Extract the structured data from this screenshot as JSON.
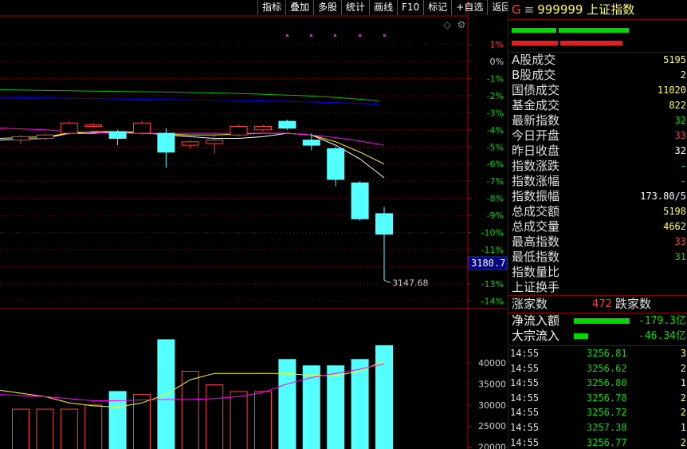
{
  "toolbar": [
    "指标",
    "叠加",
    "多股",
    "统计",
    "画线",
    "F10",
    "标记",
    "+自选",
    "返回"
  ],
  "header": {
    "prefix": "G",
    "menu": "≡",
    "code": "999999",
    "name": "上证指数"
  },
  "axis": {
    "pct_labels": [
      "1%",
      "0%",
      "-1%",
      "-2%",
      "-3%",
      "-4%",
      "-5%",
      "-6%",
      "-7%",
      "-8%",
      "-9%",
      "-10%",
      "-11%",
      "-12%",
      "-13%",
      "-14%"
    ],
    "current_price_tag": "3180.7",
    "low_annotation": "3147.68",
    "vol_labels": [
      "40000",
      "35000",
      "30000",
      "25000",
      "20000"
    ]
  },
  "colors": {
    "up": "#ff4040",
    "down": "#54ffff",
    "axis": "#800000",
    "ma1": "#ffffff",
    "ma2": "#ffff00",
    "ma3": "#ff00ff",
    "ma4": "#00c000",
    "ma5": "#0000ff"
  },
  "chart_data": {
    "type": "candlestick",
    "candles": [
      {
        "o": -4.6,
        "c": -4.4,
        "h": -4.3,
        "l": -4.8
      },
      {
        "o": -4.5,
        "c": -4.3,
        "h": -4.2,
        "l": -4.6
      },
      {
        "o": -4.2,
        "c": -3.6,
        "h": -3.5,
        "l": -4.3
      },
      {
        "o": -3.8,
        "c": -3.7,
        "h": -3.6,
        "l": -3.9
      },
      {
        "o": -4.1,
        "c": -4.5,
        "h": -4.0,
        "l": -4.9
      },
      {
        "o": -4.2,
        "c": -3.6,
        "h": -3.5,
        "l": -4.3
      },
      {
        "o": -4.2,
        "c": -5.3,
        "h": -3.9,
        "l": -6.2
      },
      {
        "o": -4.9,
        "c": -4.7,
        "h": -4.6,
        "l": -5.1
      },
      {
        "o": -4.8,
        "c": -4.6,
        "h": -4.2,
        "l": -5.4
      },
      {
        "o": -4.3,
        "c": -3.8,
        "h": -3.7,
        "l": -4.4
      },
      {
        "o": -4.0,
        "c": -3.8,
        "h": -3.7,
        "l": -4.1
      },
      {
        "o": -3.5,
        "c": -3.9,
        "h": -3.4,
        "l": -4.0
      },
      {
        "o": -4.6,
        "c": -4.9,
        "h": -4.2,
        "l": -5.2
      },
      {
        "o": -5.1,
        "c": -6.9,
        "h": -5.0,
        "l": -7.3
      },
      {
        "o": -7.1,
        "c": -9.2,
        "h": -7.0,
        "l": -9.3
      },
      {
        "o": -8.9,
        "c": -10.1,
        "h": -8.5,
        "l": -12.8
      }
    ],
    "ma_series": [
      {
        "values": [
          -4.6,
          -4.5,
          -4.2,
          -4.2,
          -4.1,
          -4.15,
          -4.3,
          -4.4,
          -4.5,
          -4.5,
          -4.4,
          -4.2,
          -4.3,
          -4.9,
          -5.7,
          -6.8
        ]
      },
      {
        "values": [
          -4.5,
          -4.4,
          -4.2,
          -4.1,
          -4.1,
          -4.2,
          -4.25,
          -4.3,
          -4.3,
          -4.25,
          -4.2,
          -4.2,
          -4.3,
          -4.7,
          -5.3,
          -6.0
        ]
      },
      {
        "values": [
          -3.9,
          -4.0,
          -4.1,
          -4.15,
          -4.2,
          -4.2,
          -4.2,
          -4.2,
          -4.2,
          -4.2,
          -4.2,
          -4.2,
          -4.3,
          -4.45,
          -4.65,
          -4.9
        ]
      },
      {
        "values": [
          -1.65,
          -1.68,
          -1.7,
          -1.72,
          -1.74,
          -1.76,
          -1.78,
          -1.8,
          -1.83,
          -1.86,
          -1.9,
          -1.95,
          -2.0,
          -2.08,
          -2.18,
          -2.3
        ]
      },
      {
        "values": [
          -2.1,
          -2.12,
          -2.14,
          -2.16,
          -2.18,
          -2.2,
          -2.22,
          -2.24,
          -2.26,
          -2.28,
          -2.3,
          -2.33,
          -2.36,
          -2.4,
          -2.45,
          -2.5
        ]
      }
    ],
    "volume": [
      {
        "v": 29000,
        "up": true
      },
      {
        "v": 29000,
        "up": true
      },
      {
        "v": 29000,
        "up": true
      },
      {
        "v": 30000,
        "up": true
      },
      {
        "v": 33200,
        "up": false
      },
      {
        "v": 32500,
        "up": true
      },
      {
        "v": 45500,
        "up": false
      },
      {
        "v": 38000,
        "up": true
      },
      {
        "v": 34800,
        "up": true
      },
      {
        "v": 33200,
        "up": true
      },
      {
        "v": 33200,
        "up": true
      },
      {
        "v": 40800,
        "up": false
      },
      {
        "v": 39300,
        "up": false
      },
      {
        "v": 39300,
        "up": false
      },
      {
        "v": 40800,
        "up": false
      },
      {
        "v": 44100,
        "up": false
      }
    ],
    "vol_ma1": [
      33500,
      32000,
      30500,
      29800,
      29500,
      30500,
      32500,
      36000,
      37500,
      37500,
      37500,
      37500,
      37000,
      37000,
      38000,
      40500
    ],
    "vol_ma2": [
      32500,
      32000,
      31500,
      31000,
      31000,
      31200,
      31300,
      31300,
      31500,
      32000,
      33000,
      35000,
      36500,
      37500,
      38500,
      39800
    ]
  },
  "side": {
    "stats": [
      {
        "label": "A股成交",
        "value": "5195",
        "color": "#ffff54"
      },
      {
        "label": "B股成交",
        "value": "2",
        "color": "#ffff54"
      },
      {
        "label": "国债成交",
        "value": "11020",
        "color": "#ffff54"
      },
      {
        "label": "基金成交",
        "value": "822",
        "color": "#ffff54"
      },
      {
        "label": "最新指数",
        "value": "32",
        "color": "#00e000"
      },
      {
        "label": "今日开盘",
        "value": "33",
        "color": "#ff4040"
      },
      {
        "label": "昨日收盘",
        "value": "32",
        "color": "#ffffff"
      },
      {
        "label": "指数涨跌",
        "value": "-",
        "color": "#00e000"
      },
      {
        "label": "指数涨幅",
        "value": "-",
        "color": "#00e000"
      },
      {
        "label": "指数振幅",
        "value": "173.80/5",
        "color": "#ffffff"
      },
      {
        "label": "总成交额",
        "value": "5198",
        "color": "#ffff54"
      },
      {
        "label": "总成交量",
        "value": "4662",
        "color": "#ffff54"
      },
      {
        "label": "最高指数",
        "value": "33",
        "color": "#ff4040"
      },
      {
        "label": "最低指数",
        "value": "31",
        "color": "#00e000"
      },
      {
        "label": "指数量比",
        "value": "",
        "color": "#ffffff"
      },
      {
        "label": "上证换手",
        "value": "",
        "color": "#ffffff"
      }
    ],
    "updown": {
      "up_label": "涨家数",
      "up_value": "472",
      "down_label": "跌家数"
    },
    "flows": [
      {
        "label": "净流入额",
        "value": "-179.3亿"
      },
      {
        "label": "大宗流入",
        "value": "-46.34亿"
      }
    ],
    "ticks": [
      {
        "time": "14:55",
        "price": "3256.81",
        "vol": "3"
      },
      {
        "time": "14:55",
        "price": "3256.62",
        "vol": "2"
      },
      {
        "time": "14:55",
        "price": "3256.80",
        "vol": "1"
      },
      {
        "time": "14:55",
        "price": "3256.78",
        "vol": "2"
      },
      {
        "time": "14:55",
        "price": "3256.72",
        "vol": "2"
      },
      {
        "time": "14:55",
        "price": "3257.38",
        "vol": "1"
      },
      {
        "time": "14:55",
        "price": "3256.77",
        "vol": "2"
      }
    ]
  }
}
